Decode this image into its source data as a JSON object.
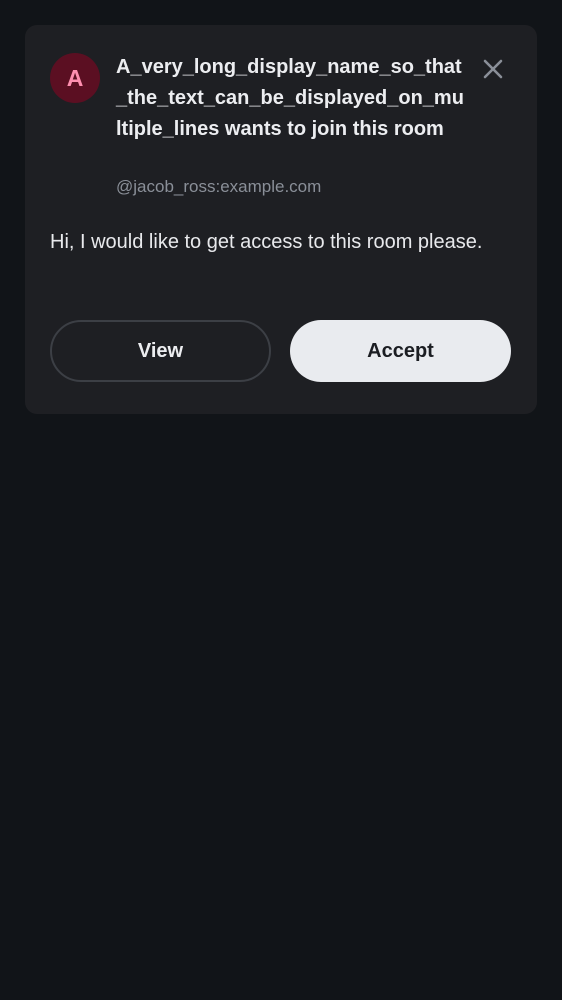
{
  "request": {
    "avatar_initial": "A",
    "title": "A_very_long_display_name_so_that_the_text_can_be_displayed_on_multiple_lines wants to join this room",
    "user_id": "@jacob_ross:example.com",
    "message": "Hi, I would like to get access to this room please.",
    "close_icon": "close-icon",
    "view_label": "View",
    "accept_label": "Accept"
  },
  "colors": {
    "background": "#111418",
    "card": "#1e1f23",
    "avatar_bg": "#5b0f22",
    "avatar_text": "#ff8fb0",
    "accept_bg": "#e9ebef"
  }
}
